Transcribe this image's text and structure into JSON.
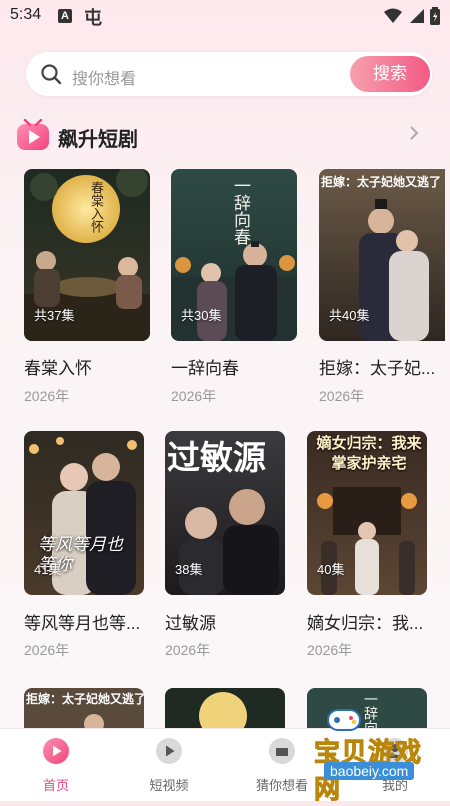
{
  "status": {
    "time": "5:34",
    "app_icon_text": "A",
    "app2_glyph": "屯"
  },
  "search": {
    "placeholder": "搜你想看",
    "button_label": "搜索"
  },
  "section": {
    "title": "飙升短剧"
  },
  "row1": [
    {
      "title": "春棠入怀",
      "year": "2026年",
      "episodes": "共37集",
      "poster_text": "春棠入怀"
    },
    {
      "title": "一辞向春",
      "year": "2026年",
      "episodes": "共30集",
      "poster_text": "一辞向春"
    },
    {
      "title": "拒嫁：太子妃...",
      "year": "2026年",
      "episodes": "共40集",
      "poster_text": "拒嫁：太子妃她又逃了"
    }
  ],
  "row2": [
    {
      "title": "等风等月也等...",
      "year": "2026年",
      "episodes": "41集",
      "poster_text": "等风等月也等你"
    },
    {
      "title": "过敏源",
      "year": "2026年",
      "episodes": "38集",
      "poster_text": "过敏源"
    },
    {
      "title": "嫡女归宗：我...",
      "year": "2026年",
      "episodes": "40集",
      "poster_text": "嫡女归宗：我来掌家护亲宅"
    }
  ],
  "row3": [
    {
      "poster_text": "拒嫁：太子妃她又逃了"
    },
    {
      "poster_text": ""
    },
    {
      "poster_text": "一辞向"
    }
  ],
  "tabs": [
    {
      "label": "首页",
      "active": true
    },
    {
      "label": "短视频",
      "active": false
    },
    {
      "label": "猜你想看",
      "active": false
    },
    {
      "label": "我的",
      "active": false
    }
  ],
  "watermark": {
    "text": "宝贝游戏网",
    "url": "baobeiy.com"
  },
  "colors": {
    "accent": "#f0457a",
    "search_btn_start": "#f7a0ac",
    "search_btn_end": "#f25a86"
  }
}
